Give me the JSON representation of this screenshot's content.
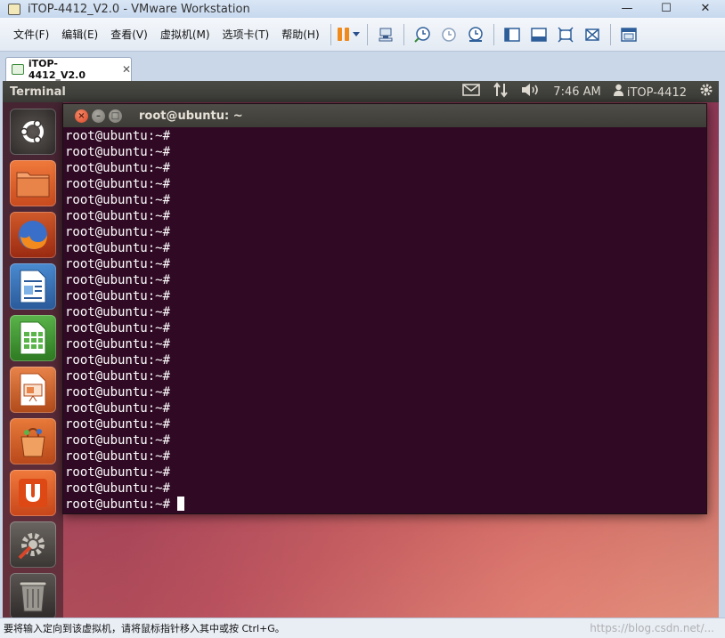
{
  "vm": {
    "window_title": "iTOP-4412_V2.0 - VMware Workstation",
    "win_controls": {
      "minimize": "—",
      "maximize": "☐",
      "close": "✕"
    },
    "menu": [
      "文件(F)",
      "编辑(E)",
      "查看(V)",
      "虚拟机(M)",
      "选项卡(T)",
      "帮助(H)"
    ],
    "tab": {
      "label": "iTOP-4412_V2.0",
      "close": "✕"
    },
    "status_text": "要将输入定向到该虚拟机，请将鼠标指针移入其中或按 Ctrl+G。",
    "watermark": "https://blog.csdn.net/..."
  },
  "guest": {
    "panel_app_name": "Terminal",
    "clock": "7:46 AM",
    "user": "iTOP-4412",
    "icons": [
      "mail-icon",
      "network-icon",
      "volume-icon",
      "user-icon",
      "gear-icon"
    ],
    "launcher": [
      "ubuntu-dash-icon",
      "files-icon",
      "firefox-icon",
      "writer-icon",
      "calc-icon",
      "impress-icon",
      "software-center-icon",
      "ubuntu-one-icon",
      "settings-icon",
      "trash-icon"
    ]
  },
  "terminal": {
    "title": "root@ubuntu: ~",
    "lines": [
      "root@ubuntu:~#",
      "root@ubuntu:~#",
      "root@ubuntu:~#",
      "root@ubuntu:~#",
      "root@ubuntu:~#",
      "root@ubuntu:~#",
      "root@ubuntu:~#",
      "root@ubuntu:~#",
      "root@ubuntu:~#",
      "root@ubuntu:~#",
      "root@ubuntu:~#",
      "root@ubuntu:~#",
      "root@ubuntu:~#",
      "root@ubuntu:~#",
      "root@ubuntu:~#",
      "root@ubuntu:~#",
      "root@ubuntu:~#",
      "root@ubuntu:~#",
      "root@ubuntu:~#",
      "root@ubuntu:~#",
      "root@ubuntu:~#",
      "root@ubuntu:~#",
      "root@ubuntu:~#",
      "root@ubuntu:~#"
    ],
    "background": "#300a24",
    "foreground": "#ffffff"
  }
}
